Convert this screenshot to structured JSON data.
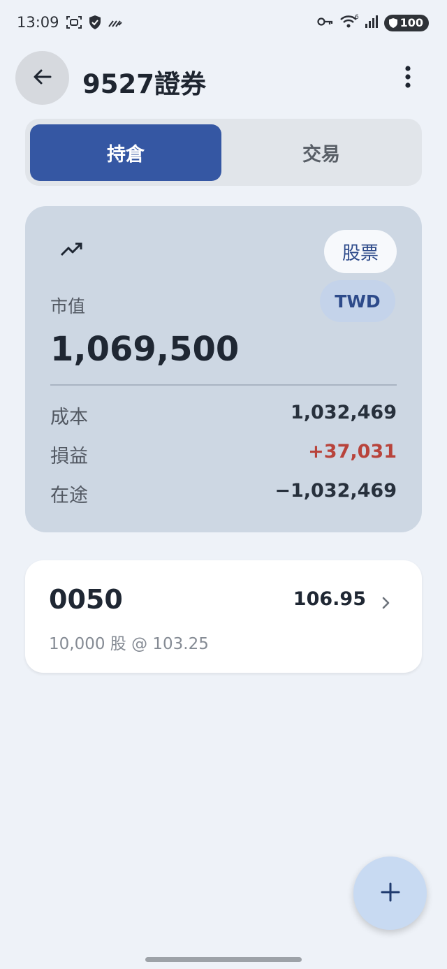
{
  "status_bar": {
    "time": "13:09",
    "battery": "100"
  },
  "app_bar": {
    "title": "9527證券"
  },
  "tabs": [
    {
      "label": "持倉",
      "active": true
    },
    {
      "label": "交易",
      "active": false
    }
  ],
  "summary": {
    "type_chip": "股票",
    "currency_chip": "TWD",
    "market_value_label": "市值",
    "market_value": "1,069,500",
    "rows": [
      {
        "label": "成本",
        "value": "1,032,469"
      },
      {
        "label": "損益",
        "value": "+37,031"
      },
      {
        "label": "在途",
        "value": "−1,032,469"
      }
    ]
  },
  "holdings": [
    {
      "symbol": "0050",
      "price": "106.95",
      "detail": "10,000 股 @ 103.25"
    }
  ],
  "colors": {
    "background": "#eef2f8",
    "primary": "#3557a3",
    "summary_card": "#cdd7e3",
    "profit": "#b8433b",
    "fab": "#c8daf2"
  },
  "icons": {
    "back": "arrow-left-icon",
    "more": "more-vert-icon",
    "trend": "trending-up-icon",
    "chevron": "chevron-right-icon",
    "fab": "plus-icon"
  }
}
